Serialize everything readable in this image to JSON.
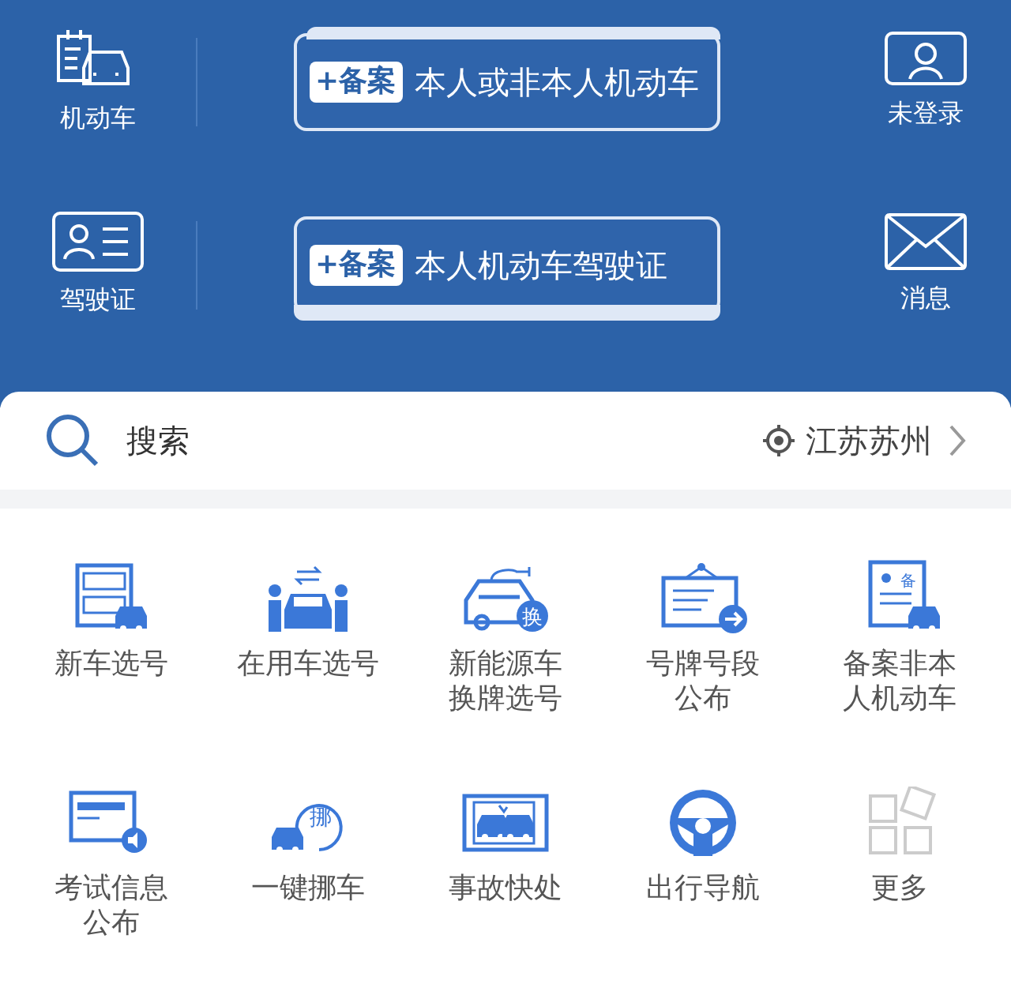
{
  "header": {
    "rows": [
      {
        "left": {
          "kind": "vehicle",
          "label": "机动车"
        },
        "banner": {
          "tag": "+备案",
          "text": "本人或非本人机动车",
          "kind": "top"
        },
        "right": {
          "kind": "user",
          "label": "未登录"
        }
      },
      {
        "left": {
          "kind": "license",
          "label": "驾驶证"
        },
        "banner": {
          "tag": "+备案",
          "text": "本人机动车驾驶证",
          "kind": "bottom"
        },
        "right": {
          "kind": "mail",
          "label": "消息"
        }
      }
    ]
  },
  "search": {
    "placeholder": "搜索",
    "location": "江苏苏州"
  },
  "services": [
    {
      "kind": "plate-new",
      "lines": [
        "新车选号"
      ]
    },
    {
      "kind": "swap",
      "lines": [
        "在用车选号"
      ]
    },
    {
      "kind": "ev",
      "badge": "换",
      "lines": [
        "新能源车",
        "换牌选号"
      ]
    },
    {
      "kind": "notice",
      "lines": [
        "号牌号段",
        "公布"
      ]
    },
    {
      "kind": "record",
      "badge": "备",
      "lines": [
        "备案非本",
        "人机动车"
      ]
    },
    {
      "kind": "exam",
      "lines": [
        "考试信息",
        "公布"
      ]
    },
    {
      "kind": "move",
      "badge": "挪",
      "lines": [
        "一键挪车"
      ]
    },
    {
      "kind": "accident",
      "lines": [
        "事故快处"
      ]
    },
    {
      "kind": "nav",
      "lines": [
        "出行导航"
      ]
    },
    {
      "kind": "more",
      "lines": [
        "更多"
      ]
    }
  ]
}
